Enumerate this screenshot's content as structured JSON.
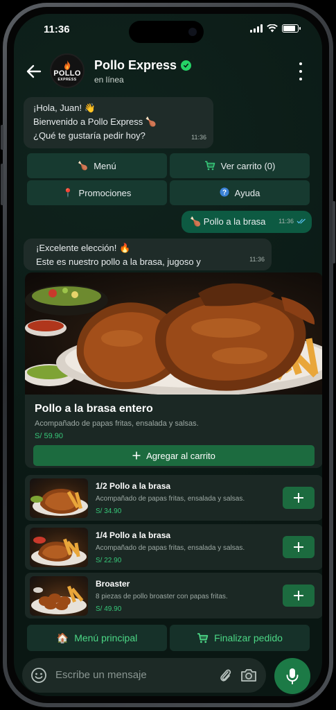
{
  "status_bar": {
    "time": "11:36"
  },
  "header": {
    "name": "Pollo Express",
    "status": "en línea",
    "logo_line1": "POLLO",
    "logo_line2": "EXPRESS"
  },
  "messages": {
    "welcome": {
      "line1": "¡Hola, Juan! 👋",
      "line2": "Bienvenido a Pollo Express 🍗",
      "line3": "¿Qué te gustaría pedir hoy?",
      "time": "11:36"
    },
    "user": {
      "text": "🍗 Pollo a la brasa",
      "time": "11:36"
    },
    "reply": {
      "line1": "¡Excelente elección! 🔥",
      "line2": "Este es nuestro pollo a la brasa, jugoso y crocante.",
      "time": "11:36"
    }
  },
  "quick_buttons": {
    "menu": {
      "icon": "🍗",
      "label": "Menú"
    },
    "cart": {
      "label": "Ver carrito (0)"
    },
    "promos": {
      "icon": "📍",
      "label": "Promociones"
    },
    "help": {
      "icon": "❓",
      "label": "Ayuda"
    }
  },
  "featured": {
    "title": "Pollo a la brasa entero",
    "description": "Acompañado de papas fritas, ensalada y salsas.",
    "price": "S/ 59.90",
    "add_label": "Agregar al carrito"
  },
  "items": [
    {
      "name": "1/2 Pollo a la brasa",
      "description": "Acompañado de papas fritas, ensalada y salsas.",
      "price": "S/ 34.90"
    },
    {
      "name": "1/4 Pollo a la brasa",
      "description": "Acompañado de papas fritas, ensalada y salsas.",
      "price": "S/ 22.90"
    },
    {
      "name": "Broaster",
      "description": "8 piezas de pollo broaster con papas fritas.",
      "price": "S/ 49.90"
    }
  ],
  "bottom_buttons": {
    "main_menu": {
      "icon": "🏠",
      "label": "Menú principal"
    },
    "checkout": {
      "label": "Finalizar pedido"
    }
  },
  "composer": {
    "placeholder": "Escribe un mensaje"
  },
  "colors": {
    "accent": "#25d366",
    "button_green": "#1c6b3f",
    "price_green": "#37c779",
    "outgoing_bubble": "#0d5a42"
  }
}
